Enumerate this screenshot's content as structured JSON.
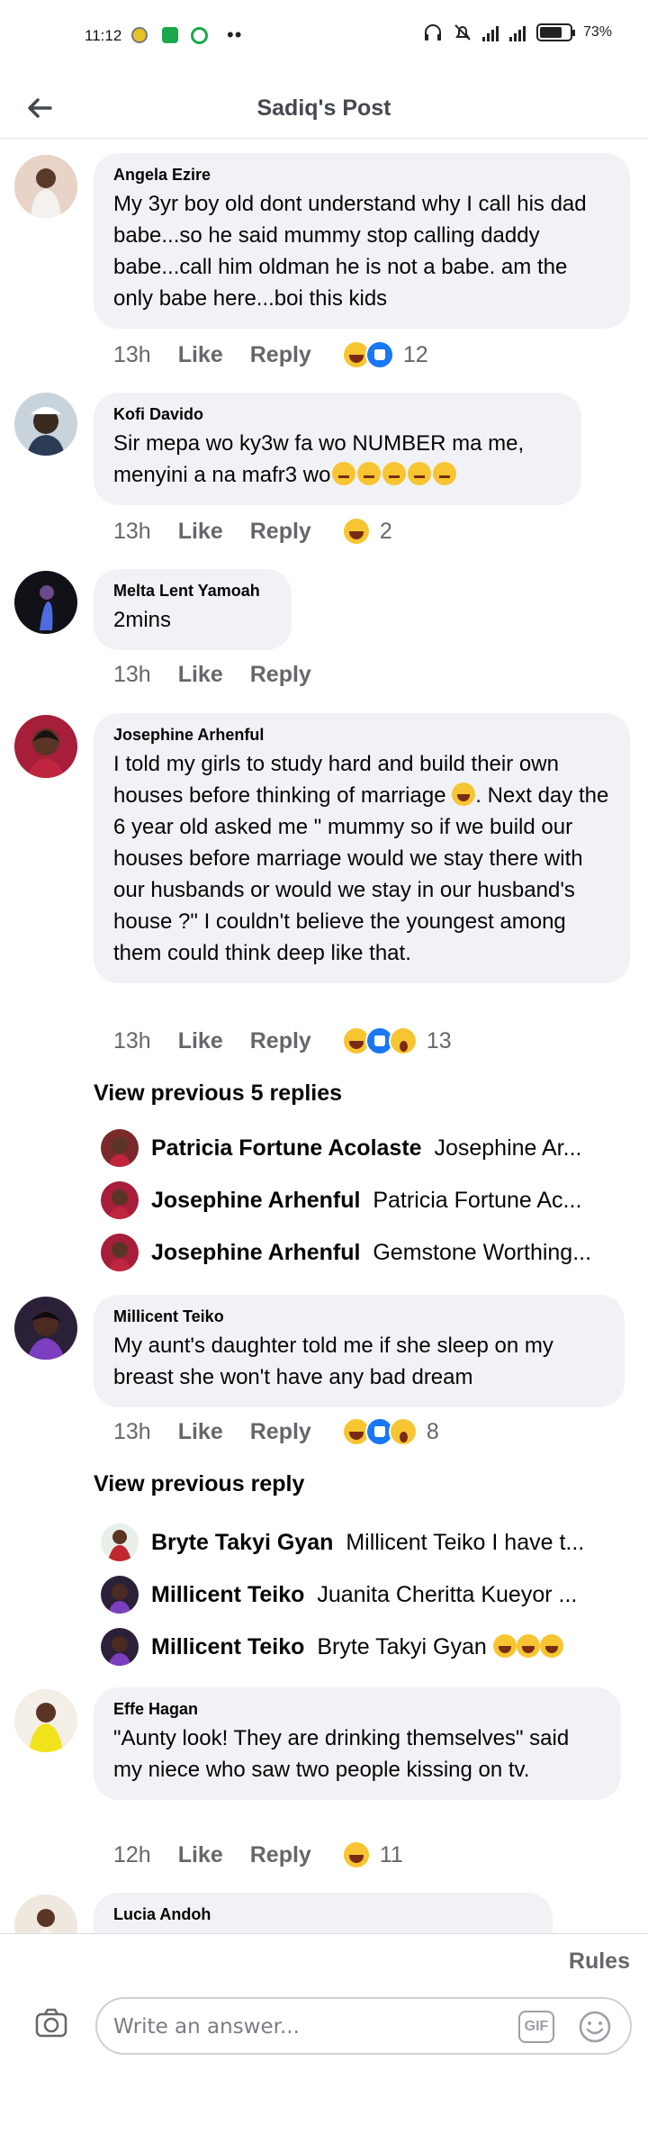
{
  "status_bar": {
    "time": "11:12",
    "battery": "73%"
  },
  "header": {
    "title": "Sadiq's Post"
  },
  "comments": [
    {
      "author": "Angela Ezire",
      "text": "My 3yr boy old dont understand why I call his dad babe...so he said mummy stop calling daddy babe...call him oldman he is not a babe. am the only babe here...boi this kids",
      "time": "13h",
      "like": "Like",
      "reply": "Reply",
      "reactions": [
        "haha",
        "like"
      ],
      "reaction_count": "12"
    },
    {
      "author": "Kofi Davido",
      "text": "Sir mepa wo ky3w fa wo NUMBER ma me, menyini a na mafr3 wo",
      "time": "13h",
      "like": "Like",
      "reply": "Reply",
      "reactions": [
        "haha"
      ],
      "reaction_count": "2"
    },
    {
      "author": "Melta Lent Yamoah",
      "text": "2mins",
      "time": "13h",
      "like": "Like",
      "reply": "Reply"
    },
    {
      "author": "Josephine Arhenful",
      "text": "I told my girls to study hard and build their own houses before thinking of marriage",
      "text_cont": ". Next day the 6 year old asked me \" mummy so if we build our houses before marriage would we stay there with our husbands or would we stay in our husband's house ?\" I couldn't believe the youngest among them could think deep like that.",
      "time": "13h",
      "like": "Like",
      "reply": "Reply",
      "reactions": [
        "haha",
        "like",
        "wow"
      ],
      "reaction_count": "13",
      "view_previous": "View previous 5 replies",
      "replies": [
        {
          "author": "Patricia Fortune Acolaste",
          "text": "Josephine Ar..."
        },
        {
          "author": "Josephine Arhenful",
          "text": "Patricia Fortune Ac..."
        },
        {
          "author": "Josephine Arhenful",
          "text": "Gemstone Worthing..."
        }
      ]
    },
    {
      "author": "Millicent Teiko",
      "text": "My aunt's daughter told me if she sleep on my breast she won't have any bad dream",
      "time": "13h",
      "like": "Like",
      "reply": "Reply",
      "reactions": [
        "haha",
        "like",
        "wow"
      ],
      "reaction_count": "8",
      "view_previous": "View previous reply",
      "replies": [
        {
          "author": "Bryte Takyi Gyan",
          "text": "Millicent Teiko I have t..."
        },
        {
          "author": "Millicent Teiko",
          "text": "Juanita Cheritta Kueyor ..."
        },
        {
          "author": "Millicent Teiko",
          "text": "Bryte Takyi Gyan"
        }
      ]
    },
    {
      "author": "Effe Hagan",
      "text": "\"Aunty look! They are drinking  themselves\" said my niece who saw two people kissing on tv.",
      "time": "12h",
      "like": "Like",
      "reply": "Reply",
      "reactions": [
        "haha"
      ],
      "reaction_count": "11"
    },
    {
      "author": "Lucia Andoh"
    }
  ],
  "composer": {
    "rules": "Rules",
    "placeholder": "Write an answer...",
    "gif": "GIF"
  },
  "icons": {
    "back": "back-arrow-icon",
    "camera": "camera-icon",
    "gif": "gif-icon",
    "emoji": "smiley-icon"
  },
  "colors": {
    "bubble": "#f0f2f5",
    "like_blue": "#1877f2",
    "meta_gray": "#65676b"
  }
}
